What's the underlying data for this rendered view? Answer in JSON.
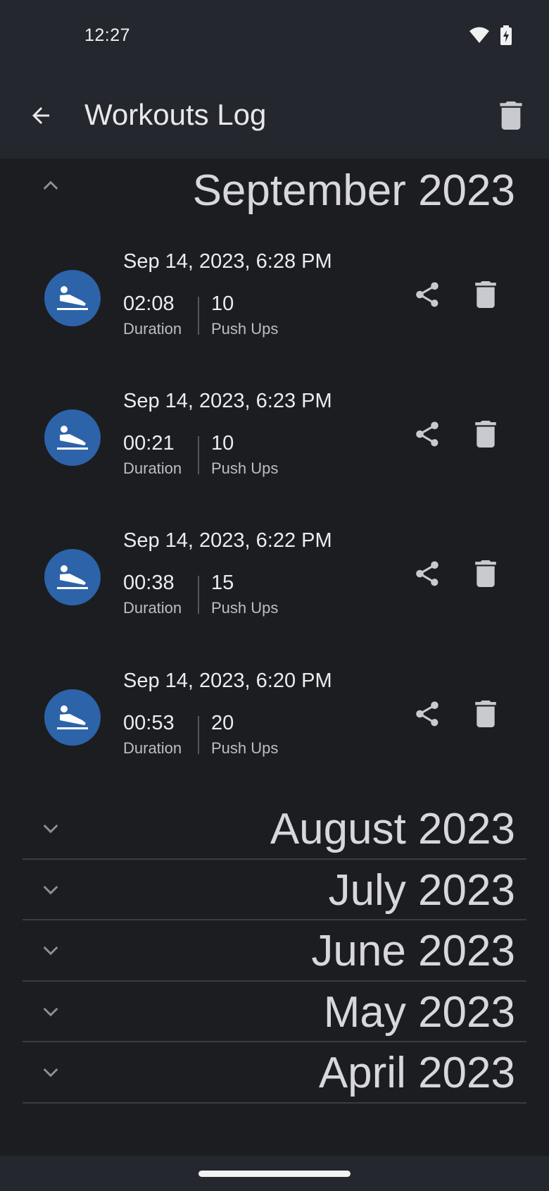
{
  "status_bar": {
    "time": "12:27",
    "icons": [
      "wifi-icon",
      "battery-charging-icon"
    ]
  },
  "app_bar": {
    "title": "Workouts Log",
    "back_icon": "arrow-back-icon",
    "action_icon": "delete-icon"
  },
  "colors": {
    "background": "#1c1d20",
    "bar": "#24272d",
    "avatar": "#2d63a8",
    "text": "#ececef",
    "secondary_text": "#bdbec3",
    "icon": "#c9cacf"
  },
  "months": [
    {
      "label": "September 2023",
      "expanded": true,
      "entries": [
        {
          "date": "Sep 14, 2023, 6:28 PM",
          "duration": "02:08",
          "duration_label": "Duration",
          "count": "10",
          "count_label": "Push Ups"
        },
        {
          "date": "Sep 14, 2023, 6:23 PM",
          "duration": "00:21",
          "duration_label": "Duration",
          "count": "10",
          "count_label": "Push Ups"
        },
        {
          "date": "Sep 14, 2023, 6:22 PM",
          "duration": "00:38",
          "duration_label": "Duration",
          "count": "15",
          "count_label": "Push Ups"
        },
        {
          "date": "Sep 14, 2023, 6:20 PM",
          "duration": "00:53",
          "duration_label": "Duration",
          "count": "20",
          "count_label": "Push Ups"
        }
      ]
    },
    {
      "label": "August 2023",
      "expanded": false
    },
    {
      "label": "July 2023",
      "expanded": false
    },
    {
      "label": "June 2023",
      "expanded": false
    },
    {
      "label": "May 2023",
      "expanded": false
    },
    {
      "label": "April 2023",
      "expanded": false
    }
  ]
}
